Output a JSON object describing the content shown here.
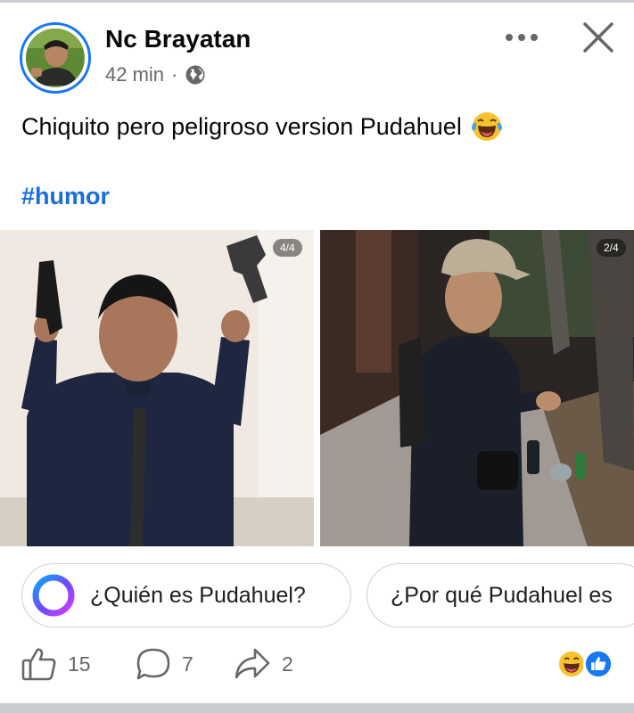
{
  "post": {
    "author": "Nc Brayatan",
    "time": "42 min",
    "separator": "·",
    "privacy_icon": "globe-icon",
    "caption": "Chiquito pero peligroso version Pudahuel",
    "caption_emoji": "laughing-tears-emoji",
    "hashtag": "#humor"
  },
  "photos": [
    {
      "badge": "4/4"
    },
    {
      "badge": "2/4"
    }
  ],
  "suggestions": [
    {
      "icon": "meta-ai-icon",
      "label": "¿Quién es Pudahuel?"
    },
    {
      "label": "¿Por qué Pudahuel es"
    }
  ],
  "actions": {
    "like_count": "15",
    "comment_count": "7",
    "share_count": "2"
  },
  "reactions": [
    "haha-reaction-icon",
    "like-reaction-icon"
  ],
  "colors": {
    "accent": "#1877f2",
    "hashtag": "#1a6ed8",
    "secondary_text": "#65676b",
    "divider": "#c9ccd1"
  }
}
